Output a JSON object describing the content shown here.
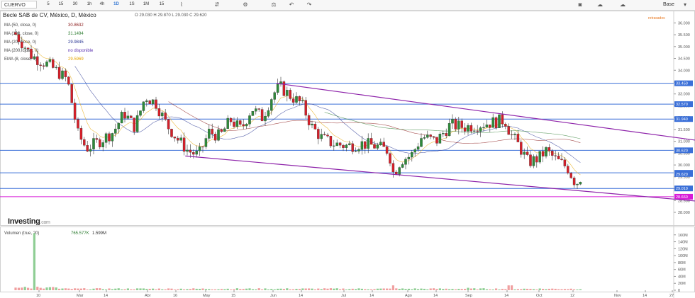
{
  "toolbar": {
    "symbol": "CUERVO",
    "intervals": [
      "5",
      "15",
      "30",
      "1h",
      "4h",
      "1D",
      "1S",
      "1M",
      "15"
    ],
    "active_interval": "1D",
    "icons": [
      "indicators-icon",
      "compare-icon",
      "settings-icon",
      "financials-icon",
      "undo-icon",
      "redo-icon",
      "camera-icon",
      "cloud-icon",
      "cloud-upload-icon",
      "scale-label",
      "chevron-down-icon"
    ],
    "scale_label": "Base"
  },
  "legend": {
    "title": "Becle SAB de CV, México, D, México",
    "ohlc": "O 29.030 H 29.870 L 29.030 C 29.620",
    "delayed": "retrasados",
    "indicators": [
      {
        "label": "MA (50, close, 0)",
        "value": "30.8632",
        "color": "#8b1a1a"
      },
      {
        "label": "MA (100, close, 0)",
        "value": "31.1494",
        "color": "#2e7d32"
      },
      {
        "label": "MA (20, close, 0)",
        "value": "29.9845",
        "color": "#283593"
      },
      {
        "label": "MA (200, close, 0)",
        "value": "no disponible",
        "color": "#5e35b1"
      },
      {
        "label": "EMA (8, close, 0)",
        "value": "29.5969",
        "color": "#e6a500"
      }
    ],
    "volume": {
      "label": "Volumen (true, 20)",
      "values": [
        "765.577K",
        "1.599M"
      ],
      "colors": [
        "#2e7d32",
        "#333333"
      ]
    }
  },
  "branding": {
    "logo": "Investing",
    "suffix": ".com"
  },
  "chart_data": {
    "type": "candlestick",
    "price_axis": {
      "ticks": [
        "36.000",
        "35.500",
        "35.000",
        "34.500",
        "34.000",
        "33.500",
        "33.000",
        "32.500",
        "32.000",
        "31.500",
        "31.000",
        "30.500",
        "30.000",
        "29.500",
        "29.000",
        "28.500",
        "28.000"
      ],
      "min": 28.0,
      "max": 36.25
    },
    "horizontal_levels": [
      {
        "value": 33.45,
        "label": "33.450",
        "color": "#3a6fd8"
      },
      {
        "value": 32.57,
        "label": "32.570",
        "color": "#3a6fd8"
      },
      {
        "value": 31.94,
        "label": "31.940",
        "color": "#3a6fd8"
      },
      {
        "value": 30.62,
        "label": "30.620",
        "color": "#3a6fd8"
      },
      {
        "value": 29.67,
        "label": "29.670",
        "color": "#3a6fd8"
      },
      {
        "value": 29.01,
        "label": "29.010",
        "color": "#3a6fd8"
      },
      {
        "value": 28.66,
        "label": "28.660",
        "color": "#d81bd8"
      }
    ],
    "last_price": {
      "value": 29.62,
      "label": "29.620"
    },
    "x_axis_labels": [
      "10",
      "Mar",
      "14",
      "Abr",
      "16",
      "May",
      "15",
      "Jun",
      "14",
      "Jul",
      "14",
      "Ago",
      "14",
      "Sep",
      "14",
      "Oct",
      "12",
      "Nov",
      "14",
      "27"
    ],
    "channel": [
      {
        "x1": 0.41,
        "y1": 33.45,
        "x2": 1.0,
        "y2": 31.05
      },
      {
        "x1": 0.275,
        "y1": 30.38,
        "x2": 1.0,
        "y2": 28.48
      }
    ],
    "volume_axis": {
      "ticks": [
        "160M",
        "140M",
        "120M",
        "100M",
        "80M",
        "60M",
        "40M",
        "20M",
        "0"
      ],
      "max": 180
    }
  }
}
